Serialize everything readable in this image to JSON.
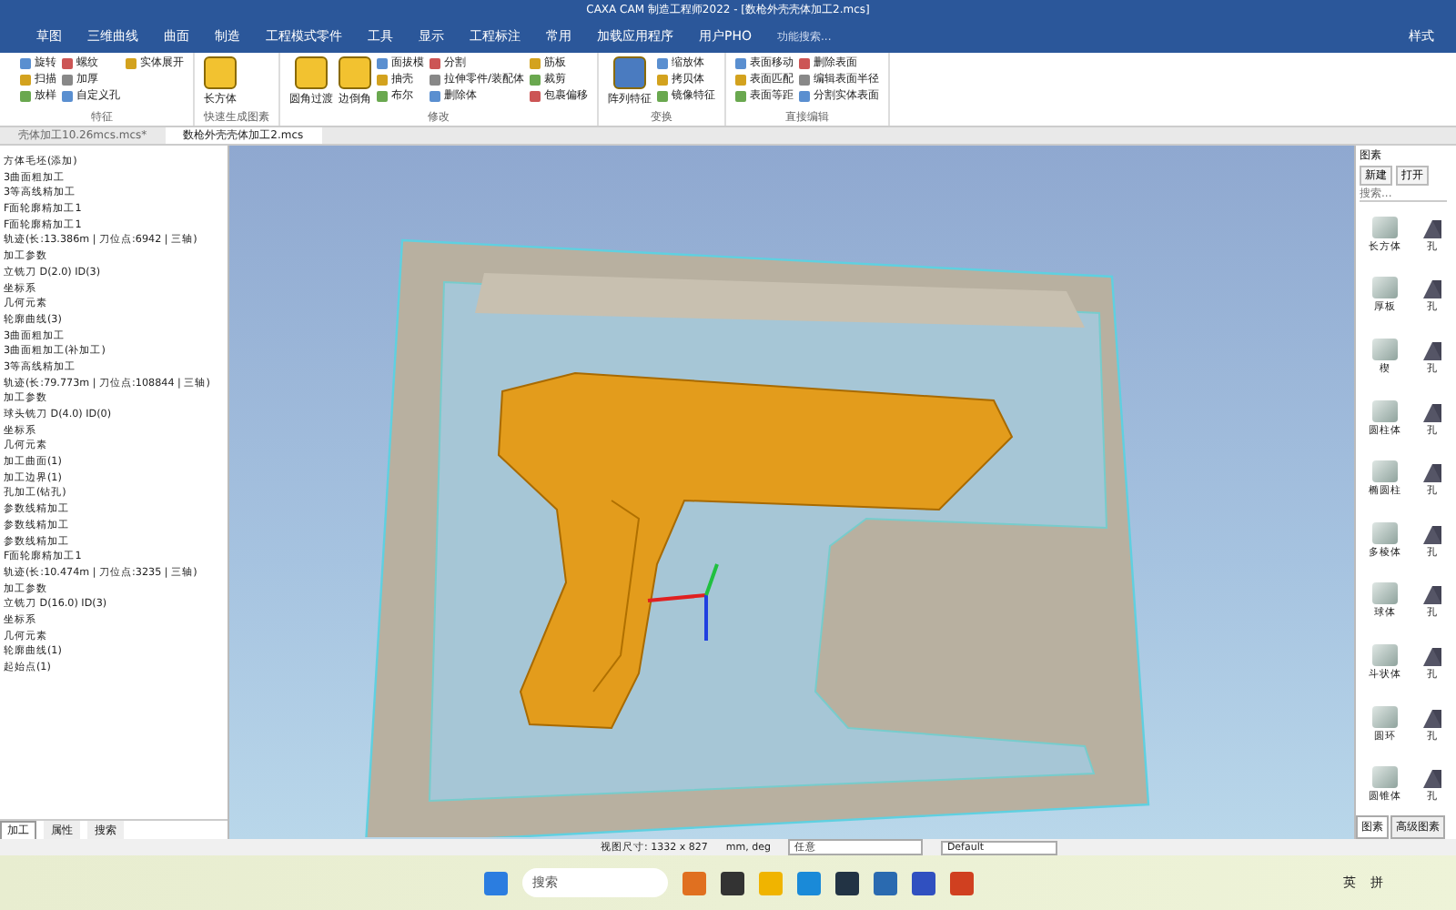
{
  "title_bar": {
    "title": "CAXA CAM 制造工程师2022 - [数枪外壳壳体加工2.mcs]"
  },
  "menu_tabs": [
    {
      "label": "草图",
      "selected": false
    },
    {
      "label": "三维曲线",
      "selected": false
    },
    {
      "label": "曲面",
      "selected": false
    },
    {
      "label": "制造",
      "selected": false
    },
    {
      "label": "工程模式零件",
      "selected": false
    },
    {
      "label": "工具",
      "selected": false
    },
    {
      "label": "显示",
      "selected": false
    },
    {
      "label": "工程标注",
      "selected": false
    },
    {
      "label": "常用",
      "selected": false
    },
    {
      "label": "加载应用程序",
      "selected": false
    },
    {
      "label": "用户PHO",
      "selected": false
    }
  ],
  "function_search": {
    "placeholder": "功能搜索..."
  },
  "style_label": "样式",
  "ribbon_groups": [
    {
      "label": "特征",
      "items": [
        {
          "label": "旋转",
          "kind": "small"
        },
        {
          "label": "扫描",
          "kind": "small"
        },
        {
          "label": "放样",
          "kind": "small"
        },
        {
          "label": "螺纹",
          "kind": "small"
        },
        {
          "label": "加厚",
          "kind": "small"
        },
        {
          "label": "自定义孔",
          "kind": "small"
        },
        {
          "label": "实体展开",
          "kind": "small"
        }
      ]
    },
    {
      "label": "快速生成图素",
      "items": [
        {
          "label": "长方体",
          "kind": "large"
        }
      ]
    },
    {
      "label": "修改",
      "items": [
        {
          "label": "圆角过渡",
          "kind": "large"
        },
        {
          "label": "边倒角",
          "kind": "large"
        },
        {
          "label": "面拔模",
          "kind": "small"
        },
        {
          "label": "抽壳",
          "kind": "small"
        },
        {
          "label": "布尔",
          "kind": "small"
        },
        {
          "label": "分割",
          "kind": "small"
        },
        {
          "label": "拉伸零件/装配体",
          "kind": "small"
        },
        {
          "label": "删除体",
          "kind": "small"
        },
        {
          "label": "筋板",
          "kind": "small"
        },
        {
          "label": "裁剪",
          "kind": "small"
        },
        {
          "label": "包裹偏移",
          "kind": "small"
        }
      ]
    },
    {
      "label": "变换",
      "items": [
        {
          "label": "阵列特征",
          "kind": "large"
        },
        {
          "label": "缩放体",
          "kind": "small"
        },
        {
          "label": "拷贝体",
          "kind": "small"
        },
        {
          "label": "镜像特征",
          "kind": "small"
        }
      ]
    },
    {
      "label": "直接编辑",
      "items": [
        {
          "label": "表面移动",
          "kind": "small"
        },
        {
          "label": "表面匹配",
          "kind": "small"
        },
        {
          "label": "表面等距",
          "kind": "small"
        },
        {
          "label": "删除表面",
          "kind": "small"
        },
        {
          "label": "编辑表面半径",
          "kind": "small"
        },
        {
          "label": "分割实体表面",
          "kind": "small"
        }
      ]
    }
  ],
  "doc_tabs": [
    {
      "label": "壳体加工10.26mcs.mcs*",
      "selected": false
    },
    {
      "label": "数枪外壳壳体加工2.mcs",
      "selected": true
    }
  ],
  "tree_lines": [
    "方体毛坯(添加)",
    "3曲面粗加工",
    "3等高线精加工",
    "F面轮廓精加工1",
    "F面轮廓精加工1",
    "轨迹(长:13.386m | 刀位点:6942 | 三轴)",
    "加工参数",
    "立铣刀 D(2.0) ID(3)",
    "坐标系",
    "几何元素",
    "轮廓曲线(3)",
    "3曲面粗加工",
    "3曲面粗加工(补加工)",
    "3等高线精加工",
    "轨迹(长:79.773m | 刀位点:108844 | 三轴)",
    "加工参数",
    "球头铣刀 D(4.0) ID(0)",
    "坐标系",
    "几何元素",
    "加工曲面(1)",
    "加工边界(1)",
    "孔加工(钻孔)",
    "参数线精加工",
    "参数线精加工",
    "参数线精加工",
    "F面轮廓精加工1",
    "轨迹(长:10.474m | 刀位点:3235 | 三轴)",
    "加工参数",
    "立铣刀 D(16.0) ID(3)",
    "坐标系",
    "几何元素",
    "轮廓曲线(1)",
    "起始点(1)"
  ],
  "panel_tabs": [
    {
      "label": "加工",
      "selected": true
    },
    {
      "label": "属性",
      "selected": false
    },
    {
      "label": "搜索",
      "selected": false
    }
  ],
  "library": {
    "title": "图素",
    "buttons": [
      "新建",
      "打开"
    ],
    "search": {
      "placeholder": "搜索..."
    },
    "items": [
      {
        "label": "长方体",
        "side": "孔"
      },
      {
        "label": "厚板",
        "side": "孔"
      },
      {
        "label": "楔",
        "side": "孔"
      },
      {
        "label": "圆柱体",
        "side": "孔"
      },
      {
        "label": "椭圆柱",
        "side": "孔"
      },
      {
        "label": "多棱体",
        "side": "孔"
      },
      {
        "label": "球体",
        "side": "孔"
      },
      {
        "label": "斗状体",
        "side": "孔"
      },
      {
        "label": "圆环",
        "side": "孔"
      },
      {
        "label": "圆锥体",
        "side": "孔"
      }
    ],
    "tabs": [
      {
        "label": "图素",
        "selected": true
      },
      {
        "label": "高级图素",
        "selected": false
      }
    ]
  },
  "status_bar": {
    "view_size": "视图尺寸: 1332 x 827",
    "units": "mm, deg",
    "filter": "任意",
    "style": "Default"
  },
  "taskbar": {
    "search": {
      "placeholder": "搜索"
    },
    "tray": [
      "英",
      "拼"
    ]
  }
}
